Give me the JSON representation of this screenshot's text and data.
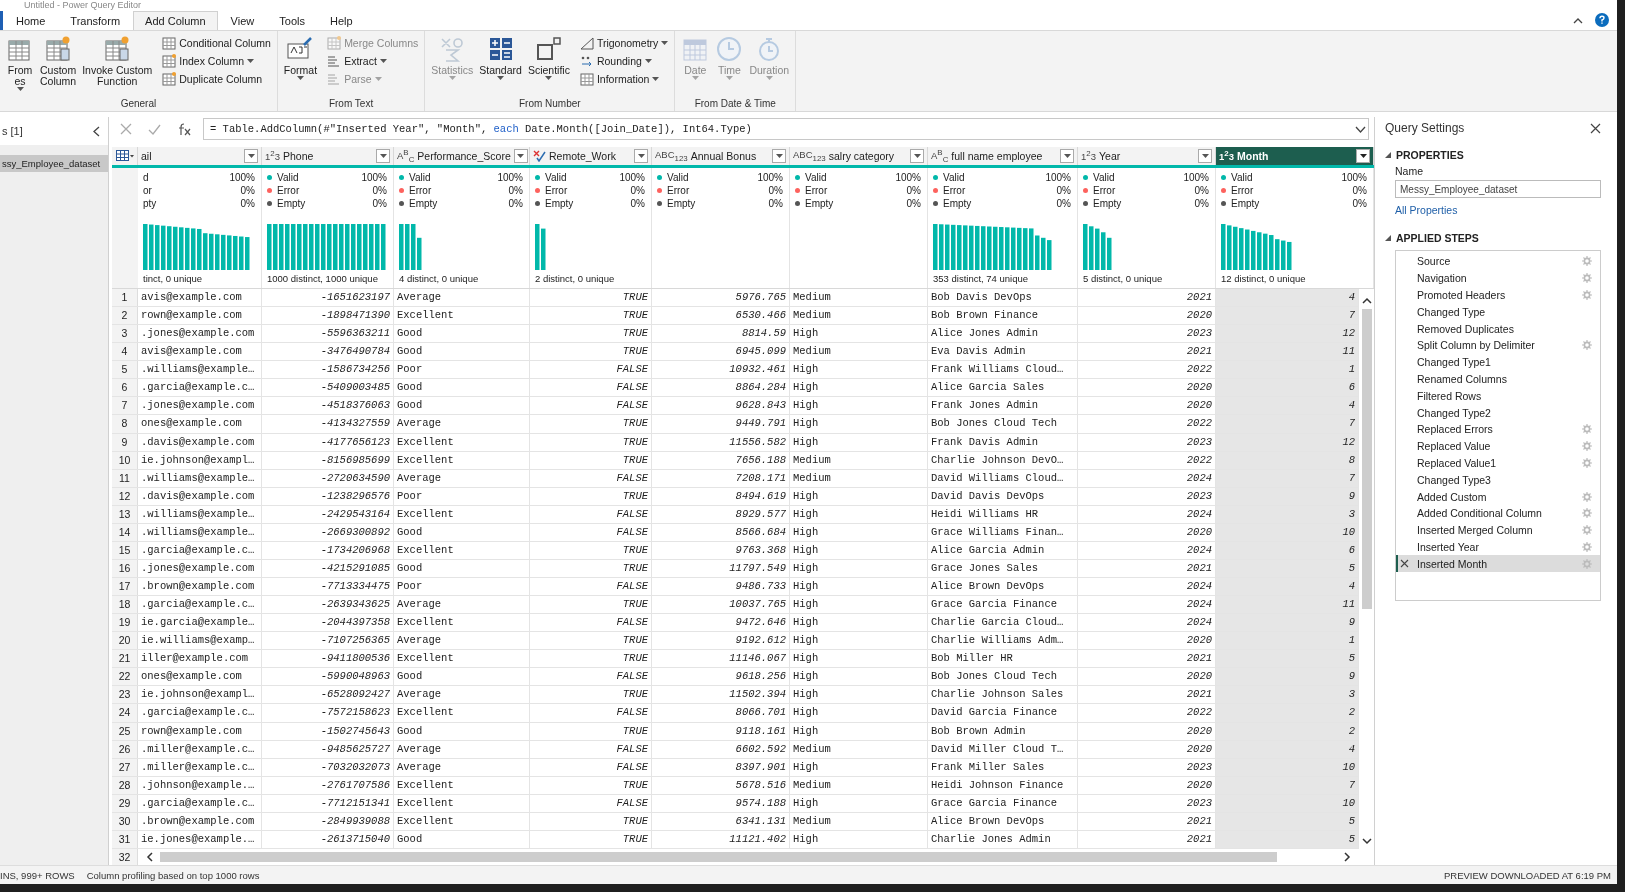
{
  "window": {
    "title": "Untitled - Power Query Editor"
  },
  "tabs": [
    {
      "label": "Home",
      "selected": false
    },
    {
      "label": "Transform",
      "selected": false
    },
    {
      "label": "Add Column",
      "selected": true
    },
    {
      "label": "View",
      "selected": false
    },
    {
      "label": "Tools",
      "selected": false
    },
    {
      "label": "Help",
      "selected": false
    }
  ],
  "ribbon": [
    {
      "label": "General",
      "items": [
        {
          "kind": "large",
          "lines": [
            "From",
            "es"
          ],
          "dropdown": true,
          "disabled": false
        },
        {
          "kind": "large",
          "lines": [
            "Custom",
            "Column"
          ],
          "dropdown": false,
          "disabled": false
        },
        {
          "kind": "large",
          "lines": [
            "Invoke Custom",
            "Function"
          ],
          "dropdown": false,
          "disabled": false
        },
        {
          "kind": "small",
          "lines": [
            "Conditional Column"
          ],
          "dropdown": false,
          "disabled": false
        },
        {
          "kind": "small",
          "lines": [
            "Index Column"
          ],
          "dropdown": true,
          "disabled": false
        },
        {
          "kind": "small",
          "lines": [
            "Duplicate Column"
          ],
          "dropdown": false,
          "disabled": false
        }
      ]
    },
    {
      "label": "From Text",
      "items": [
        {
          "kind": "large",
          "lines": [
            "Format"
          ],
          "dropdown": true,
          "disabled": false
        },
        {
          "kind": "small",
          "lines": [
            "Merge Columns"
          ],
          "dropdown": false,
          "disabled": true
        },
        {
          "kind": "small",
          "lines": [
            "Extract"
          ],
          "dropdown": true,
          "disabled": false
        },
        {
          "kind": "small",
          "lines": [
            "Parse"
          ],
          "dropdown": true,
          "disabled": true
        }
      ]
    },
    {
      "label": "From Number",
      "items": [
        {
          "kind": "large",
          "lines": [
            "Statistics"
          ],
          "dropdown": true,
          "disabled": true
        },
        {
          "kind": "large",
          "lines": [
            "Standard"
          ],
          "dropdown": true,
          "disabled": false
        },
        {
          "kind": "large",
          "lines": [
            "Scientific"
          ],
          "dropdown": true,
          "disabled": false
        },
        {
          "kind": "small",
          "lines": [
            "Trigonometry"
          ],
          "dropdown": true,
          "disabled": false
        },
        {
          "kind": "small",
          "lines": [
            "Rounding"
          ],
          "dropdown": true,
          "disabled": false
        },
        {
          "kind": "small",
          "lines": [
            "Information"
          ],
          "dropdown": true,
          "disabled": false
        }
      ]
    },
    {
      "label": "From Date & Time",
      "items": [
        {
          "kind": "large",
          "lines": [
            "Date"
          ],
          "dropdown": true,
          "disabled": true
        },
        {
          "kind": "large",
          "lines": [
            "Time"
          ],
          "dropdown": true,
          "disabled": true
        },
        {
          "kind": "large",
          "lines": [
            "Duration"
          ],
          "dropdown": true,
          "disabled": true
        }
      ]
    }
  ],
  "queries": {
    "title": "s [1]",
    "items": [
      {
        "label": "ssy_Employee_dataset",
        "selected": true
      }
    ]
  },
  "formula": {
    "tokens": [
      {
        "text": "= Table.AddColumn(#\"Inserted Year\", \"Month\", ",
        "kind": "plain"
      },
      {
        "text": "each",
        "kind": "keyword"
      },
      {
        "text": " Date.Month([Join_Date]), Int64.Type)",
        "kind": "plain"
      }
    ]
  },
  "table": {
    "columns": [
      {
        "name": "ail",
        "kind": "text",
        "selected": false,
        "profile": {
          "stats": [
            {
              "label": "d",
              "value": "100%"
            },
            {
              "label": "or",
              "value": "0%"
            },
            {
              "label": "pty",
              "value": "0%"
            }
          ],
          "distinct": "tinct, 0 unique"
        }
      },
      {
        "name": "Phone",
        "type_label": "1$^{2}$3",
        "kind": "number",
        "selected": false,
        "profile": {
          "stats": [
            {
              "label": "Valid",
              "value": "100%",
              "color": "#01b8aa"
            },
            {
              "label": "Error",
              "value": "0%",
              "color": "#fd625e"
            },
            {
              "label": "Empty",
              "value": "0%",
              "color": "#555555"
            }
          ],
          "distinct": "1000 distinct, 1000 unique"
        }
      },
      {
        "name": "Performance_Score",
        "type_label": "A$^{B}$$_{C}$",
        "kind": "text",
        "selected": false,
        "profile": {
          "stats": [
            {
              "label": "Valid",
              "value": "100%",
              "color": "#01b8aa"
            },
            {
              "label": "Error",
              "value": "0%",
              "color": "#fd625e"
            },
            {
              "label": "Empty",
              "value": "0%",
              "color": "#555555"
            }
          ],
          "distinct": "4 distinct, 0 unique"
        }
      },
      {
        "name": "Remote_Work",
        "kind": "logical",
        "selected": false,
        "profile": {
          "stats": [
            {
              "label": "Valid",
              "value": "100%",
              "color": "#01b8aa"
            },
            {
              "label": "Error",
              "value": "0%",
              "color": "#fd625e"
            },
            {
              "label": "Empty",
              "value": "0%",
              "color": "#555555"
            }
          ],
          "distinct": "2 distinct, 0 unique"
        }
      },
      {
        "name": "Annual Bonus",
        "type_label": "ABC$_{123}$",
        "kind": "number",
        "selected": false,
        "profile": {
          "stats": [
            {
              "label": "Valid",
              "value": "100%",
              "color": "#01b8aa"
            },
            {
              "label": "Error",
              "value": "0%",
              "color": "#fd625e"
            },
            {
              "label": "Empty",
              "value": "0%",
              "color": "#555555"
            }
          ]
        }
      },
      {
        "name": "salry category",
        "type_label": "ABC$_{123}$",
        "kind": "text",
        "selected": false,
        "profile": {
          "stats": [
            {
              "label": "Valid",
              "value": "100%",
              "color": "#01b8aa"
            },
            {
              "label": "Error",
              "value": "0%",
              "color": "#fd625e"
            },
            {
              "label": "Empty",
              "value": "0%",
              "color": "#555555"
            }
          ]
        }
      },
      {
        "name": "full name employee",
        "type_label": "A$^{B}$$_{C}$",
        "kind": "text",
        "selected": false,
        "profile": {
          "stats": [
            {
              "label": "Valid",
              "value": "100%",
              "color": "#01b8aa"
            },
            {
              "label": "Error",
              "value": "0%",
              "color": "#fd625e"
            },
            {
              "label": "Empty",
              "value": "0%",
              "color": "#555555"
            }
          ],
          "distinct": "353 distinct, 74 unique"
        }
      },
      {
        "name": "Year",
        "type_label": "1$^{2}$3",
        "kind": "number",
        "selected": false,
        "profile": {
          "stats": [
            {
              "label": "Valid",
              "value": "100%",
              "color": "#01b8aa"
            },
            {
              "label": "Error",
              "value": "0%",
              "color": "#fd625e"
            },
            {
              "label": "Empty",
              "value": "0%",
              "color": "#555555"
            }
          ],
          "distinct": "5 distinct, 0 unique"
        }
      },
      {
        "name": "Month",
        "type_label": "1$^{2}$3",
        "kind": "number",
        "selected": true,
        "profile": {
          "stats": [
            {
              "label": "Valid",
              "value": "100%",
              "color": "#01b8aa"
            },
            {
              "label": "Error",
              "value": "0%",
              "color": "#fd625e"
            },
            {
              "label": "Empty",
              "value": "0%",
              "color": "#555555"
            }
          ],
          "distinct": "12 distinct, 0 unique"
        }
      }
    ],
    "rows": [
      {
        "n": "1",
        "cells": [
          "avis@example.com",
          "-1651623197",
          "Average",
          "TRUE",
          "5976.765",
          "Medium",
          "Bob Davis DevOps",
          "2021",
          "4"
        ]
      },
      {
        "n": "2",
        "cells": [
          "rown@example.com",
          "-1898471390",
          "Excellent",
          "TRUE",
          "6530.466",
          "Medium",
          "Bob Brown Finance",
          "2020",
          "7"
        ]
      },
      {
        "n": "3",
        "cells": [
          ".jones@example.com",
          "-5596363211",
          "Good",
          "TRUE",
          "8814.59",
          "High",
          "Alice Jones Admin",
          "2023",
          "12"
        ]
      },
      {
        "n": "4",
        "cells": [
          "avis@example.com",
          "-3476490784",
          "Good",
          "TRUE",
          "6945.099",
          "Medium",
          "Eva Davis Admin",
          "2021",
          "11"
        ]
      },
      {
        "n": "5",
        "cells": [
          ".williams@example…",
          "-1586734256",
          "Poor",
          "FALSE",
          "10932.461",
          "High",
          "Frank Williams Cloud…",
          "2022",
          "1"
        ]
      },
      {
        "n": "6",
        "cells": [
          ".garcia@example.c…",
          "-5409003485",
          "Good",
          "FALSE",
          "8864.284",
          "High",
          "Alice Garcia Sales",
          "2020",
          "6"
        ]
      },
      {
        "n": "7",
        "cells": [
          ".jones@example.com",
          "-4518376063",
          "Good",
          "FALSE",
          "9628.843",
          "High",
          "Frank Jones Admin",
          "2020",
          "4"
        ]
      },
      {
        "n": "8",
        "cells": [
          "ones@example.com",
          "-4134327559",
          "Average",
          "TRUE",
          "9449.791",
          "High",
          "Bob Jones Cloud Tech",
          "2022",
          "7"
        ]
      },
      {
        "n": "9",
        "cells": [
          ".davis@example.com",
          "-4177656123",
          "Excellent",
          "TRUE",
          "11556.582",
          "High",
          "Frank Davis Admin",
          "2023",
          "12"
        ]
      },
      {
        "n": "10",
        "cells": [
          "ie.johnson@exampl…",
          "-8156985699",
          "Excellent",
          "TRUE",
          "7656.188",
          "Medium",
          "Charlie Johnson DevO…",
          "2022",
          "8"
        ]
      },
      {
        "n": "11",
        "cells": [
          ".williams@example…",
          "-2720634590",
          "Average",
          "FALSE",
          "7208.171",
          "Medium",
          "David Williams Cloud…",
          "2024",
          "7"
        ]
      },
      {
        "n": "12",
        "cells": [
          ".davis@example.com",
          "-1238296576",
          "Poor",
          "TRUE",
          "8494.619",
          "High",
          "David Davis DevOps",
          "2023",
          "9"
        ]
      },
      {
        "n": "13",
        "cells": [
          ".williams@example…",
          "-2429543164",
          "Excellent",
          "FALSE",
          "8929.577",
          "High",
          "Heidi Williams HR",
          "2024",
          "3"
        ]
      },
      {
        "n": "14",
        "cells": [
          ".williams@example…",
          "-2669300892",
          "Good",
          "FALSE",
          "8566.684",
          "High",
          "Grace Williams Finan…",
          "2020",
          "10"
        ]
      },
      {
        "n": "15",
        "cells": [
          ".garcia@example.c…",
          "-1734206968",
          "Excellent",
          "TRUE",
          "9763.368",
          "High",
          "Alice Garcia Admin",
          "2024",
          "6"
        ]
      },
      {
        "n": "16",
        "cells": [
          ".jones@example.com",
          "-4215291085",
          "Good",
          "TRUE",
          "11797.549",
          "High",
          "Grace Jones Sales",
          "2021",
          "5"
        ]
      },
      {
        "n": "17",
        "cells": [
          ".brown@example.com",
          "-7713334475",
          "Poor",
          "FALSE",
          "9486.733",
          "High",
          "Alice Brown DevOps",
          "2024",
          "4"
        ]
      },
      {
        "n": "18",
        "cells": [
          ".garcia@example.c…",
          "-2639343625",
          "Average",
          "TRUE",
          "10037.765",
          "High",
          "Grace Garcia Finance",
          "2024",
          "11"
        ]
      },
      {
        "n": "19",
        "cells": [
          "ie.garcia@example…",
          "-2044397358",
          "Excellent",
          "FALSE",
          "9472.646",
          "High",
          "Charlie Garcia Cloud…",
          "2024",
          "9"
        ]
      },
      {
        "n": "20",
        "cells": [
          "ie.williams@examp…",
          "-7107256365",
          "Average",
          "TRUE",
          "9192.612",
          "High",
          "Charlie Williams Adm…",
          "2020",
          "1"
        ]
      },
      {
        "n": "21",
        "cells": [
          "iller@example.com",
          "-9411800536",
          "Excellent",
          "TRUE",
          "11146.067",
          "High",
          "Bob Miller HR",
          "2021",
          "5"
        ]
      },
      {
        "n": "22",
        "cells": [
          "ones@example.com",
          "-5990048963",
          "Good",
          "FALSE",
          "9618.256",
          "High",
          "Bob Jones Cloud Tech",
          "2020",
          "9"
        ]
      },
      {
        "n": "23",
        "cells": [
          "ie.johnson@exampl…",
          "-6528092427",
          "Average",
          "TRUE",
          "11502.394",
          "High",
          "Charlie Johnson Sales",
          "2021",
          "3"
        ]
      },
      {
        "n": "24",
        "cells": [
          ".garcia@example.c…",
          "-7572158623",
          "Excellent",
          "FALSE",
          "8066.701",
          "High",
          "David Garcia Finance",
          "2022",
          "2"
        ]
      },
      {
        "n": "25",
        "cells": [
          "rown@example.com",
          "-1502745643",
          "Good",
          "TRUE",
          "9118.161",
          "High",
          "Bob Brown Admin",
          "2020",
          "2"
        ]
      },
      {
        "n": "26",
        "cells": [
          ".miller@example.c…",
          "-9485625727",
          "Average",
          "FALSE",
          "6602.592",
          "Medium",
          "David Miller Cloud T…",
          "2020",
          "4"
        ]
      },
      {
        "n": "27",
        "cells": [
          ".miller@example.c…",
          "-7032032073",
          "Average",
          "FALSE",
          "8397.901",
          "High",
          "Frank Miller Sales",
          "2023",
          "10"
        ]
      },
      {
        "n": "28",
        "cells": [
          ".johnson@example.…",
          "-2761707586",
          "Excellent",
          "TRUE",
          "5678.516",
          "Medium",
          "Heidi Johnson Finance",
          "2020",
          "7"
        ]
      },
      {
        "n": "29",
        "cells": [
          ".garcia@example.c…",
          "-7712151341",
          "Excellent",
          "FALSE",
          "9574.188",
          "High",
          "Grace Garcia Finance",
          "2023",
          "10"
        ]
      },
      {
        "n": "30",
        "cells": [
          ".brown@example.com",
          "-2849939088",
          "Excellent",
          "TRUE",
          "6341.131",
          "Medium",
          "Alice Brown DevOps",
          "2021",
          "5"
        ]
      },
      {
        "n": "31",
        "cells": [
          "ie.jones@example.…",
          "-2613715040",
          "Good",
          "TRUE",
          "11121.402",
          "High",
          "Charlie Jones Admin",
          "2021",
          "5"
        ]
      }
    ],
    "last_row_number": "32"
  },
  "settings": {
    "title": "Query Settings",
    "properties_heading": "PROPERTIES",
    "name_label": "Name",
    "name_value": "Messy_Employee_dataset",
    "all_properties": "All Properties",
    "steps_heading": "APPLIED STEPS",
    "steps": [
      {
        "label": "Source",
        "settings": true,
        "selected": false
      },
      {
        "label": "Navigation",
        "settings": true,
        "selected": false
      },
      {
        "label": "Promoted Headers",
        "settings": true,
        "selected": false
      },
      {
        "label": "Changed Type",
        "settings": false,
        "selected": false
      },
      {
        "label": "Removed Duplicates",
        "settings": false,
        "selected": false
      },
      {
        "label": "Split Column by Delimiter",
        "settings": true,
        "selected": false
      },
      {
        "label": "Changed Type1",
        "settings": false,
        "selected": false
      },
      {
        "label": "Renamed Columns",
        "settings": false,
        "selected": false
      },
      {
        "label": "Filtered Rows",
        "settings": false,
        "selected": false
      },
      {
        "label": "Changed Type2",
        "settings": false,
        "selected": false
      },
      {
        "label": "Replaced Errors",
        "settings": true,
        "selected": false
      },
      {
        "label": "Replaced Value",
        "settings": true,
        "selected": false
      },
      {
        "label": "Replaced Value1",
        "settings": true,
        "selected": false
      },
      {
        "label": "Changed Type3",
        "settings": false,
        "selected": false
      },
      {
        "label": "Added Custom",
        "settings": true,
        "selected": false
      },
      {
        "label": "Added Conditional Column",
        "settings": true,
        "selected": false
      },
      {
        "label": "Inserted Merged Column",
        "settings": true,
        "selected": false
      },
      {
        "label": "Inserted Year",
        "settings": true,
        "selected": false
      },
      {
        "label": "Inserted Month",
        "settings": true,
        "selected": true
      }
    ]
  },
  "status_bar": {
    "left": "INS, 999+ ROWS",
    "profiling": "Column profiling based on top 1000 rows",
    "right": "PREVIEW DOWNLOADED AT 6:19 PM"
  }
}
